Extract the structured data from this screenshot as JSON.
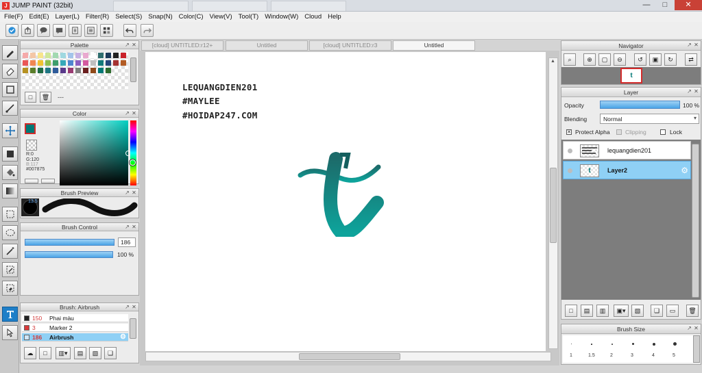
{
  "window": {
    "title": "JUMP PAINT (32bit)",
    "logo_letter": "J",
    "minimize": "—",
    "maximize": "□",
    "close": "✕"
  },
  "menu": [
    "File(F)",
    "Edit(E)",
    "Layer(L)",
    "Filter(R)",
    "Select(S)",
    "Snap(N)",
    "Color(C)",
    "View(V)",
    "Tool(T)",
    "Window(W)",
    "Cloud",
    "Help"
  ],
  "palette": {
    "title": "Palette",
    "extra_label": "---",
    "swatches": [
      "#f5a9a9",
      "#f4c7a6",
      "#f7e58c",
      "#cfe79a",
      "#a3d9b1",
      "#9fd8e0",
      "#a3c4ea",
      "#c7b1e3",
      "#e9a9cf",
      "#ffffff",
      "#2f6e6f",
      "#1c3a5a",
      "#222222",
      "#c9212a",
      "#ea5757",
      "#f08752",
      "#f1c232",
      "#8fbf4f",
      "#3e9e6c",
      "#36a9b9",
      "#4f86cf",
      "#8c5fc1",
      "#d45ba0",
      "#bfbfbf",
      "#147a7a",
      "#26467a",
      "#a53232",
      "#b35c24",
      "#b69121",
      "#5a7e2a",
      "#1f6b45",
      "#1f7784",
      "#2e5b9a",
      "#5a3a8b",
      "#983b72",
      "#7f7f7f",
      "#6b2020",
      "#8f4a1a",
      "#007875",
      "#2d6b2d"
    ]
  },
  "color_panel": {
    "title": "Color",
    "r": "R:0",
    "g": "G:120",
    "b": "B:117",
    "hex": "#007875",
    "current": "#007875"
  },
  "brush_preview": {
    "title": "Brush Preview",
    "size": "13.5"
  },
  "brush_control": {
    "title": "Brush Control",
    "size_value": "186",
    "opacity_value": "100 %",
    "size_fraction": 1.0,
    "opacity_fraction": 1.0
  },
  "brush_list": {
    "title": "Brush: Airbrush",
    "items": [
      {
        "num": "150",
        "name": "Phai màu",
        "color": "#222222"
      },
      {
        "num": "3",
        "name": "Marker 2",
        "color": "#d93a3a"
      },
      {
        "num": "186",
        "name": "Airbrush",
        "color": "#cfe6f7"
      }
    ]
  },
  "tabs": [
    {
      "label": "[cloud] UNTITLED:r12+"
    },
    {
      "label": "Untitled"
    },
    {
      "label": "[cloud] UNTITLED:r3"
    },
    {
      "label": "Untitled"
    }
  ],
  "canvas": {
    "lines": [
      "LEQUANGDIEN201",
      "#MAYLEE",
      "#HOIDAP247.COM"
    ],
    "stroke_color": "#007875"
  },
  "navigator": {
    "title": "Navigator",
    "preview_letter": "t"
  },
  "layer_panel": {
    "title": "Layer",
    "opacity_label": "Opacity",
    "opacity_value": "100 %",
    "opacity_fraction": 1.0,
    "blending_label": "Blending",
    "blending_value": "Normal",
    "protect_alpha": "Protect Alpha",
    "clipping": "Clipping",
    "lock": "Lock",
    "thumb_glyph": "t",
    "layers": [
      {
        "name": "lequangdien201"
      },
      {
        "name": "Layer2"
      }
    ]
  },
  "brush_size": {
    "title": "Brush Size",
    "sizes": [
      "1",
      "1.5",
      "2",
      "3",
      "4",
      "5"
    ]
  }
}
